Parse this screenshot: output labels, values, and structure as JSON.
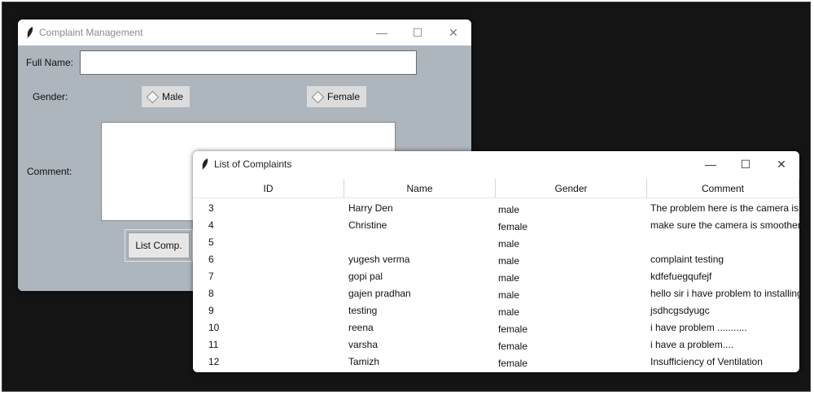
{
  "complaint_window": {
    "title": "Complaint Management",
    "controls": {
      "minimize": "—",
      "maximize": "☐",
      "close": "✕"
    },
    "full_name": {
      "label": "Full Name:",
      "value": ""
    },
    "gender": {
      "label": "Gender:",
      "options": [
        "Male",
        "Female"
      ]
    },
    "comment": {
      "label": "Comment:",
      "value": ""
    },
    "list_button": "List Comp."
  },
  "list_window": {
    "title": "List of Complaints",
    "controls": {
      "minimize": "—",
      "maximize": "☐",
      "close": "✕"
    },
    "columns": [
      "ID",
      "Name",
      "Gender",
      "Comment"
    ],
    "rows": [
      {
        "id": "3",
        "name": "Harry Den",
        "gender": "male",
        "comment": "The problem here is the camera is dif"
      },
      {
        "id": "4",
        "name": "Christine",
        "gender": "female",
        "comment": "make sure the camera is smoother. S"
      },
      {
        "id": "5",
        "name": "",
        "gender": "male",
        "comment": ""
      },
      {
        "id": "6",
        "name": "yugesh verma",
        "gender": "male",
        "comment": "complaint testing"
      },
      {
        "id": "7",
        "name": "gopi pal",
        "gender": "male",
        "comment": "kdfefuegqufejf"
      },
      {
        "id": "8",
        "name": "gajen pradhan",
        "gender": "male",
        "comment": "hello sir i have problem to installing"
      },
      {
        "id": "9",
        "name": "testing",
        "gender": "male",
        "comment": "jsdhcgsdyugc"
      },
      {
        "id": "10",
        "name": "reena",
        "gender": "female",
        "comment": "i have problem ..........."
      },
      {
        "id": "11",
        "name": "varsha",
        "gender": "female",
        "comment": "i have a problem...."
      },
      {
        "id": "12",
        "name": "Tamizh",
        "gender": "female",
        "comment": "Insufficiency of Ventilation"
      }
    ]
  }
}
